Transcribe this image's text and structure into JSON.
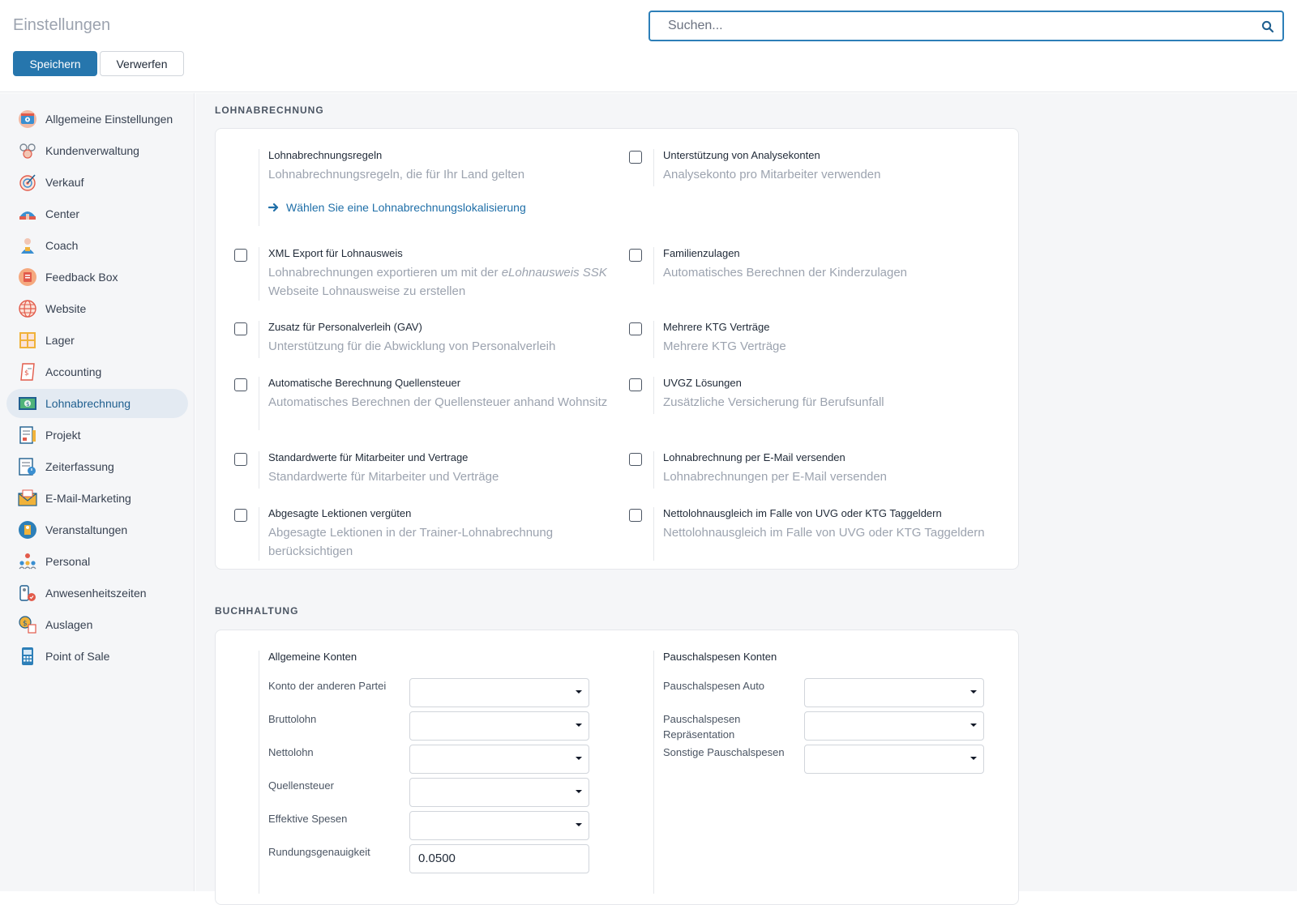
{
  "header": {
    "title": "Einstellungen",
    "save_label": "Speichern",
    "discard_label": "Verwerfen",
    "search_placeholder": "Suchen..."
  },
  "sidebar": {
    "items": [
      {
        "label": "Allgemeine Einstellungen",
        "icon": "settings-app-icon"
      },
      {
        "label": "Kundenverwaltung",
        "icon": "crm-app-icon"
      },
      {
        "label": "Verkauf",
        "icon": "sales-target-icon"
      },
      {
        "label": "Center",
        "icon": "center-app-icon"
      },
      {
        "label": "Coach",
        "icon": "coach-app-icon"
      },
      {
        "label": "Feedback Box",
        "icon": "feedback-box-icon"
      },
      {
        "label": "Website",
        "icon": "website-globe-icon"
      },
      {
        "label": "Lager",
        "icon": "inventory-app-icon"
      },
      {
        "label": "Accounting",
        "icon": "accounting-app-icon"
      },
      {
        "label": "Lohnabrechnung",
        "icon": "payroll-app-icon",
        "active": true
      },
      {
        "label": "Projekt",
        "icon": "project-app-icon"
      },
      {
        "label": "Zeiterfassung",
        "icon": "timesheet-app-icon"
      },
      {
        "label": "E-Mail-Marketing",
        "icon": "email-marketing-icon"
      },
      {
        "label": "Veranstaltungen",
        "icon": "events-app-icon"
      },
      {
        "label": "Personal",
        "icon": "employees-app-icon"
      },
      {
        "label": "Anwesenheitszeiten",
        "icon": "attendance-app-icon"
      },
      {
        "label": "Auslagen",
        "icon": "expenses-app-icon"
      },
      {
        "label": "Point of Sale",
        "icon": "pos-app-icon"
      }
    ]
  },
  "payroll": {
    "section_title": "LOHNABRECHNUNG",
    "rules": {
      "title": "Lohnabrechnungsregeln",
      "desc": "Lohnabrechnungsregeln, die für Ihr Land gelten",
      "link": "Wählen Sie eine Lohnabrechnungslokalisierung"
    },
    "analytic": {
      "title": "Unterstützung von Analysekonten",
      "desc": "Analysekonto pro Mitarbeiter verwenden",
      "checked": false
    },
    "xml_export": {
      "title": "XML Export für Lohnausweis",
      "desc_pre": "Lohnabrechnungen exportieren um mit der ",
      "desc_em": "eLohnausweis SSK",
      "desc_post": " Webseite Lohnausweise zu erstellen",
      "checked": false
    },
    "family": {
      "title": "Familienzulagen",
      "desc": "Automatisches Berechnen der Kinderzulagen",
      "checked": false
    },
    "gav": {
      "title": "Zusatz für Personalverleih (GAV)",
      "desc": "Unterstützung für die Abwicklung von Personalverleih",
      "checked": false
    },
    "ktg": {
      "title": "Mehrere KTG Verträge",
      "desc": "Mehrere KTG Verträge",
      "checked": false
    },
    "withholding": {
      "title": "Automatische Berechnung Quellensteuer",
      "desc": "Automatisches Berechnen der Quellensteuer anhand Wohnsitz",
      "checked": false
    },
    "uvgz": {
      "title": "UVGZ Lösungen",
      "desc": "Zusätzliche Versicherung für Berufsunfall",
      "checked": false
    },
    "defaults": {
      "title": "Standardwerte für Mitarbeiter und Vertrage",
      "desc": "Standardwerte für Mitarbeiter und Verträge",
      "checked": false
    },
    "email": {
      "title": "Lohnabrechnung per E-Mail versenden",
      "desc": "Lohnabrechnungen per E-Mail versenden",
      "checked": false
    },
    "lessons": {
      "title": "Abgesagte Lektionen vergüten",
      "desc": "Abgesagte Lektionen in der Trainer-Lohnabrechnung berücksichtigen",
      "checked": false
    },
    "net_comp": {
      "title": "Nettolohnausgleich im Falle von UVG oder KTG Taggeldern",
      "desc": "Nettolohnausgleich im Falle von UVG oder KTG Taggeldern",
      "checked": false
    }
  },
  "accounting": {
    "section_title": "BUCHHALTUNG",
    "general": {
      "title": "Allgemeine Konten",
      "fields": [
        {
          "label": "Konto der anderen Partei",
          "value": ""
        },
        {
          "label": "Bruttolohn",
          "value": ""
        },
        {
          "label": "Nettolohn",
          "value": ""
        },
        {
          "label": "Quellensteuer",
          "value": ""
        },
        {
          "label": "Effektive Spesen",
          "value": ""
        },
        {
          "label": "Rundungsgenauigkeit",
          "value": "0.0500"
        }
      ]
    },
    "flat": {
      "title": "Pauschalspesen Konten",
      "fields": [
        {
          "label": "Pauschalspesen Auto",
          "value": ""
        },
        {
          "label": "Pauschalspesen Repräsentation",
          "value": ""
        },
        {
          "label": "Sonstige Pauschalspesen",
          "value": ""
        }
      ]
    }
  },
  "colors": {
    "primary": "#2676ad",
    "active_bg": "#e3eaf2",
    "link": "#1f6fa8",
    "muted": "#9ca3af"
  }
}
